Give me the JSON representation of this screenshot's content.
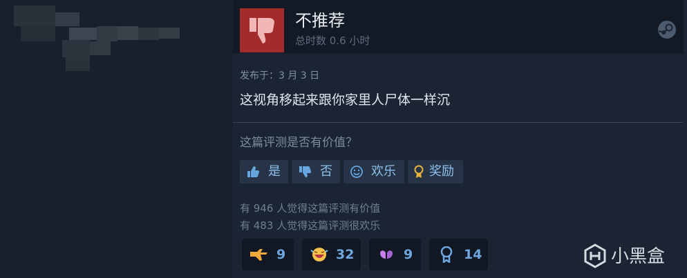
{
  "review": {
    "title": "不推荐",
    "hours": "总时数 0.6 小时",
    "posted": "发布于：3 月 3 日",
    "text": "这视角移起来跟你家里人尸体一样沉"
  },
  "helpful": {
    "question": "这篇评测是否有价值？",
    "buttons": {
      "yes": "是",
      "no": "否",
      "funny": "欢乐",
      "award": "奖励"
    }
  },
  "counts": {
    "helpful_text": "有 946 人觉得这篇评测有价值",
    "funny_text": "有 483 人觉得这篇评测很欢乐"
  },
  "awards": [
    {
      "icon": "pointing-hand-icon",
      "count": "9"
    },
    {
      "icon": "laughing-face-icon",
      "count": "32"
    },
    {
      "icon": "heart-hands-icon",
      "count": "9"
    },
    {
      "icon": "medal-icon",
      "count": "14"
    }
  ],
  "watermark": {
    "text": "小黑盒"
  },
  "colors": {
    "background": "#1b2433",
    "thumb_red": "#a22c2c",
    "link_blue": "#8ec0ec"
  }
}
